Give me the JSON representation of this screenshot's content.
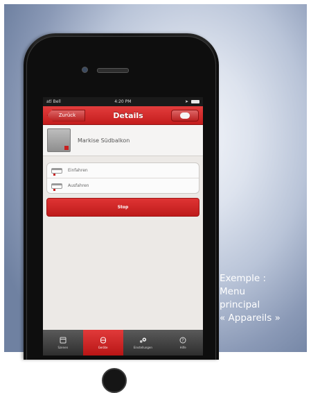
{
  "statusbar": {
    "carrier": "atl Bell",
    "time": "4:20 PM"
  },
  "navbar": {
    "back_label": "Zurück",
    "title": "Details"
  },
  "device": {
    "name": "Markise Südbalkon"
  },
  "options": [
    {
      "label": "Einfahren"
    },
    {
      "label": "Ausfahren"
    }
  ],
  "stop_button": {
    "label": "Stop"
  },
  "tabbar": {
    "tabs": [
      {
        "label": "Szenen",
        "icon": "scenes-icon",
        "active": false
      },
      {
        "label": "Geräte",
        "icon": "devices-icon",
        "active": true
      },
      {
        "label": "Einstellungen",
        "icon": "settings-icon",
        "active": false
      },
      {
        "label": "Hilfe",
        "icon": "help-icon",
        "active": false
      }
    ]
  },
  "caption": {
    "line1": "Exemple :",
    "line2": "Menu",
    "line3": "principal",
    "line4": "« Appareils »"
  },
  "colors": {
    "accent": "#c41d1d",
    "background": "#8a99b6"
  }
}
